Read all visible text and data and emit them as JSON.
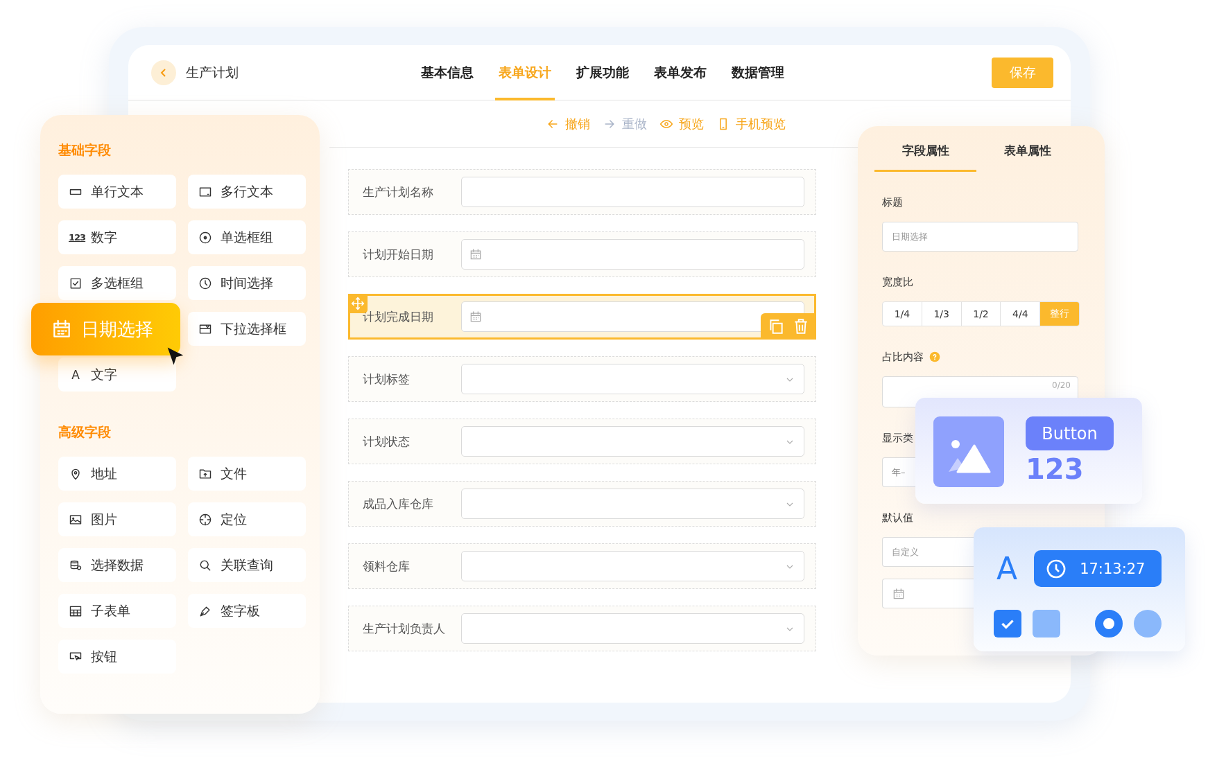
{
  "header": {
    "title": "生产计划",
    "tabs": [
      {
        "label": "基本信息",
        "selected": false
      },
      {
        "label": "表单设计",
        "selected": true
      },
      {
        "label": "扩展功能",
        "selected": false
      },
      {
        "label": "表单发布",
        "selected": false
      },
      {
        "label": "数据管理",
        "selected": false
      }
    ],
    "save_button": "保存"
  },
  "toolbar": [
    {
      "label": "撤销",
      "kind": "undo",
      "disabled": false
    },
    {
      "label": "重做",
      "kind": "redo",
      "disabled": true
    },
    {
      "label": "预览",
      "kind": "preview",
      "disabled": false
    },
    {
      "label": "手机预览",
      "kind": "mobile",
      "disabled": false
    }
  ],
  "field_palette": {
    "sections": [
      {
        "title": "基础字段",
        "items": [
          {
            "label": "单行文本",
            "kind": "single-line",
            "dragging": false
          },
          {
            "label": "多行文本",
            "kind": "multi-line",
            "dragging": false
          },
          {
            "label": "数字",
            "kind": "number",
            "icon_text": "123",
            "dragging": false
          },
          {
            "label": "单选框组",
            "kind": "radio",
            "dragging": false
          },
          {
            "label": "多选框组",
            "kind": "checkbox",
            "dragging": false
          },
          {
            "label": "时间选择",
            "kind": "time",
            "dragging": false
          },
          {
            "label": "日期选择",
            "kind": "date",
            "dragging": true
          },
          {
            "label": "下拉选择框",
            "kind": "dropdown",
            "dragging": false
          },
          {
            "label": "文字",
            "kind": "text",
            "icon_text": "A",
            "dragging": false
          }
        ]
      },
      {
        "title": "高级字段",
        "items": [
          {
            "label": "地址",
            "kind": "address",
            "dragging": false
          },
          {
            "label": "文件",
            "kind": "file",
            "dragging": false
          },
          {
            "label": "图片",
            "kind": "image",
            "dragging": false
          },
          {
            "label": "定位",
            "kind": "location",
            "dragging": false
          },
          {
            "label": "选择数据",
            "kind": "data",
            "dragging": false
          },
          {
            "label": "关联查询",
            "kind": "search",
            "dragging": false
          },
          {
            "label": "子表单",
            "kind": "table",
            "dragging": false
          },
          {
            "label": "签字板",
            "kind": "signature",
            "dragging": false
          },
          {
            "label": "按钮",
            "kind": "button",
            "dragging": false
          }
        ]
      }
    ]
  },
  "form": {
    "rows": [
      {
        "label": "生产计划名称",
        "kind": "text",
        "selected": false
      },
      {
        "label": "计划开始日期",
        "kind": "date",
        "selected": false
      },
      {
        "label": "计划完成日期",
        "kind": "date",
        "selected": true
      },
      {
        "label": "计划标签",
        "kind": "select",
        "selected": false
      },
      {
        "label": "计划状态",
        "kind": "select",
        "selected": false
      },
      {
        "label": "成品入库仓库",
        "kind": "select",
        "selected": false
      },
      {
        "label": "领料仓库",
        "kind": "select",
        "selected": false
      },
      {
        "label": "生产计划负责人",
        "kind": "select",
        "selected": false
      }
    ]
  },
  "properties": {
    "tabs": [
      {
        "label": "字段属性",
        "selected": true
      },
      {
        "label": "表单属性",
        "selected": false
      }
    ],
    "fields": [
      {
        "kind": "label",
        "text": "标题",
        "help": false
      },
      {
        "kind": "input",
        "placeholder": "日期选择"
      },
      {
        "kind": "label",
        "text": "宽度比",
        "help": false
      },
      {
        "kind": "segments",
        "options": [
          {
            "label": "1/4",
            "selected": false
          },
          {
            "label": "1/3",
            "selected": false
          },
          {
            "label": "1/2",
            "selected": false
          },
          {
            "label": "4/4",
            "selected": false
          },
          {
            "label": "整行",
            "selected": true
          }
        ]
      },
      {
        "kind": "label",
        "text": "占比内容",
        "help": true
      },
      {
        "kind": "textarea",
        "counter": "0/20"
      },
      {
        "kind": "label",
        "text": "显示类",
        "help": false
      },
      {
        "kind": "input",
        "value": "年–"
      },
      {
        "kind": "label",
        "text": "默认值",
        "help": false
      },
      {
        "kind": "input",
        "placeholder": "自定义"
      },
      {
        "kind": "date"
      }
    ]
  },
  "preview_cards": {
    "button": "Button",
    "number": "123",
    "glyph": "A",
    "time": "17:13:27",
    "checkboxes": [
      {
        "checked": true
      },
      {
        "checked": false
      }
    ],
    "radios": [
      {
        "selected": true
      },
      {
        "selected": false
      }
    ]
  }
}
